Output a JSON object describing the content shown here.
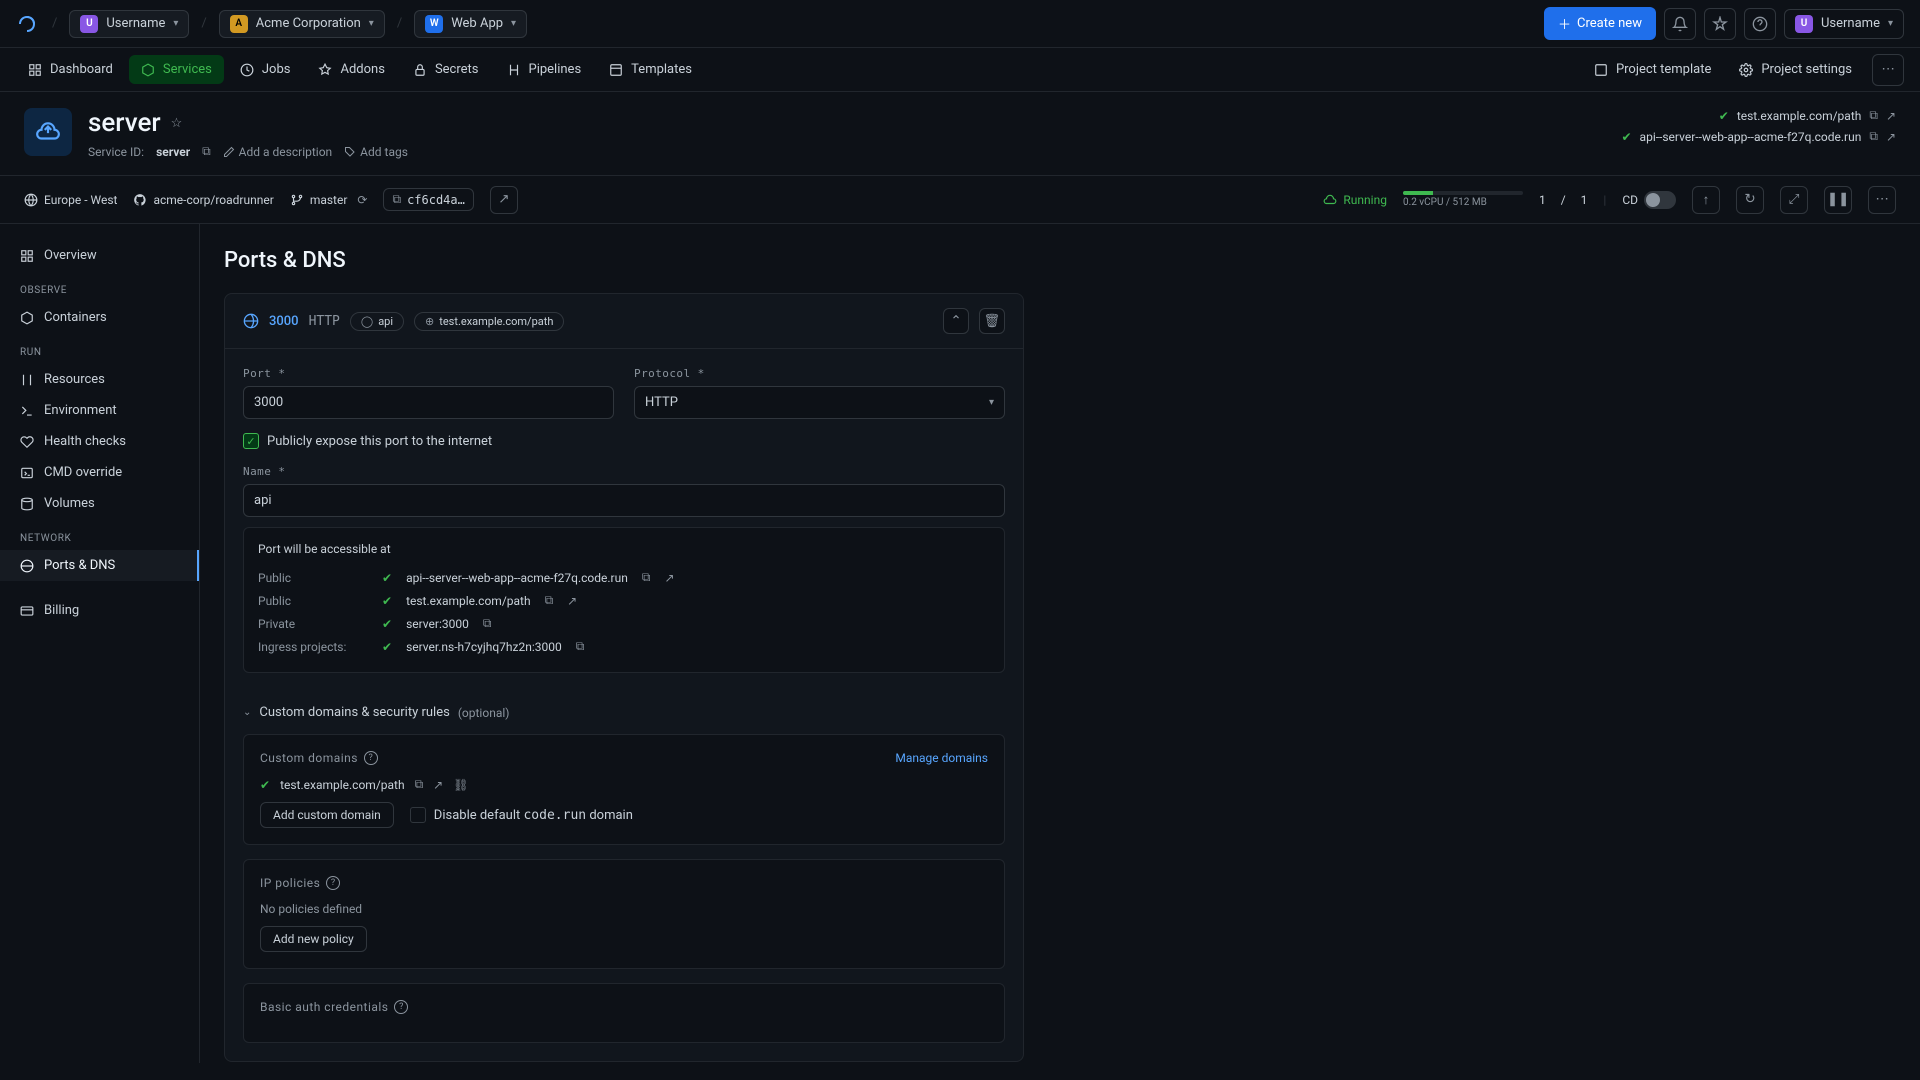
{
  "topbar": {
    "breadcrumbs": [
      {
        "avatar": "U",
        "label": "Username",
        "avclass": "av-purple"
      },
      {
        "avatar": "A",
        "label": "Acme Corporation",
        "avclass": "av-yellow"
      },
      {
        "avatar": "W",
        "label": "Web App",
        "avclass": "av-blue"
      }
    ],
    "create": "Create new",
    "user": "Username"
  },
  "navtabs": [
    "Dashboard",
    "Services",
    "Jobs",
    "Addons",
    "Secrets",
    "Pipelines",
    "Templates"
  ],
  "rightNav": {
    "projectTemplate": "Project template",
    "projectSettings": "Project settings"
  },
  "service": {
    "title": "server",
    "idLabel": "Service ID:",
    "id": "server",
    "descPlaceholder": "Add a description",
    "addTags": "Add tags",
    "urls": [
      "test.example.com/path",
      "api--server--web-app--acme-f27q.code.run"
    ]
  },
  "status": {
    "region": "Europe - West",
    "repo": "acme-corp/roadrunner",
    "branch": "master",
    "sha": "cf6cd4a…",
    "state": "Running",
    "res": "0.2 vCPU / 512 MB",
    "count": "1",
    "countSep": "/",
    "countTotal": "1",
    "cd": "CD"
  },
  "sidebar": {
    "overview": "Overview",
    "groups": [
      {
        "head": "OBSERVE",
        "items": [
          "Containers"
        ]
      },
      {
        "head": "RUN",
        "items": [
          "Resources",
          "Environment",
          "Health checks",
          "CMD override",
          "Volumes"
        ]
      },
      {
        "head": "NETWORK",
        "items": [
          "Ports & DNS"
        ]
      },
      {
        "head": "",
        "items": [
          "Billing"
        ]
      }
    ]
  },
  "page": {
    "title": "Ports & DNS",
    "port": {
      "num": "3000",
      "proto": "HTTP",
      "badges": [
        "api",
        "test.example.com/path"
      ],
      "portLabel": "Port *",
      "protoLabel": "Protocol *",
      "portVal": "3000",
      "protoVal": "HTTP",
      "expose": "Publicly expose this port to the internet",
      "nameLabel": "Name *",
      "nameVal": "api",
      "accessTitle": "Port will be accessible at",
      "access": [
        {
          "k": "Public",
          "v": "api--server--web-app--acme-f27q.code.run",
          "ext": true
        },
        {
          "k": "Public",
          "v": "test.example.com/path",
          "ext": true
        },
        {
          "k": "Private",
          "v": "server:3000",
          "ext": false
        },
        {
          "k": "Ingress projects:",
          "v": "server.ns-h7cyjhq7hz2n:3000",
          "ext": false
        }
      ]
    },
    "custom": {
      "head": "Custom domains & security rules",
      "optional": "(optional)",
      "domainsTitle": "Custom domains",
      "manage": "Manage domains",
      "domain": "test.example.com/path",
      "addDomain": "Add custom domain",
      "disableDefault": "Disable default ",
      "codeRun": "code.run",
      "disableDefault2": " domain",
      "ipTitle": "IP policies",
      "noPolicies": "No policies defined",
      "addPolicy": "Add new policy",
      "basicAuth": "Basic auth credentials"
    }
  }
}
